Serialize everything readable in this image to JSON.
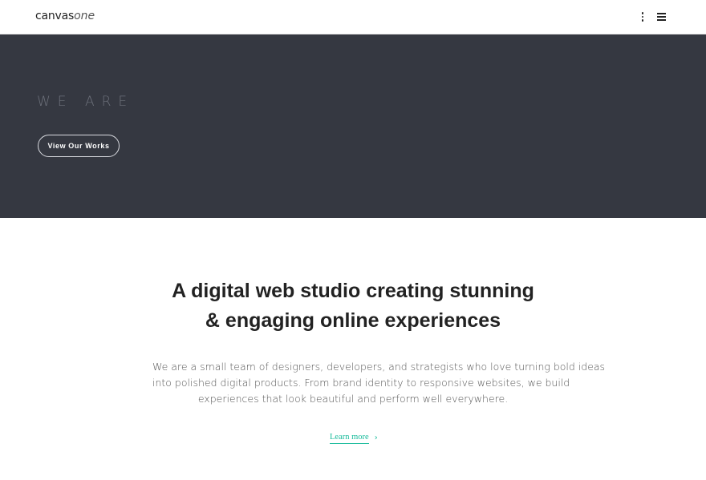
{
  "header": {
    "logo_main": "canvas",
    "logo_accent": "one",
    "icons": [
      "more-vertical-icon",
      "hamburger-menu-icon"
    ]
  },
  "hero": {
    "eyebrow": "WE ARE",
    "cta_label": "View Our Works",
    "background_color": "#353841"
  },
  "intro": {
    "title_lines": [
      "A digital web studio creating stunning",
      "& engaging online experiences"
    ],
    "body_lines": [
      "We are a small team of designers, developers, and strategists who love turning bold ideas",
      "into polished digital products. From brand identity to responsive websites, we build",
      "experiences that look beautiful and perform well everywhere."
    ],
    "link_label": "Learn more",
    "accent_color": "#1abc9c"
  }
}
